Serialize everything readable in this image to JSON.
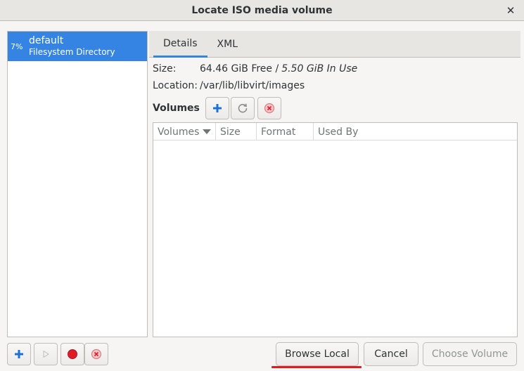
{
  "window": {
    "title": "Locate ISO media volume"
  },
  "pools": [
    {
      "percent": "7%",
      "name": "default",
      "type": "Filesystem Directory"
    }
  ],
  "tabs": [
    {
      "label": "Details",
      "active": true
    },
    {
      "label": "XML",
      "active": false
    }
  ],
  "details": {
    "size_label": "Size:",
    "size_free": "64.46 GiB Free /",
    "size_in_use": "5.50 GiB In Use",
    "location_label": "Location:",
    "location_value": "/var/lib/libvirt/images",
    "volumes_label": "Volumes"
  },
  "volume_table": {
    "columns": [
      "Volumes",
      "Size",
      "Format",
      "Used By"
    ],
    "sort_column": "Volumes",
    "rows": []
  },
  "buttons": {
    "browse_local": "Browse Local",
    "cancel": "Cancel",
    "choose_volume": "Choose Volume"
  },
  "colors": {
    "accent": "#3584e4",
    "delete_red": "#e01b24",
    "add_blue": "#1c71d8"
  },
  "icons": {
    "add_volume": "plus-icon",
    "refresh": "refresh-icon",
    "delete": "delete-icon",
    "add_pool": "plus-icon",
    "start_pool": "play-icon",
    "stop_pool": "stop-icon",
    "delete_pool": "delete-icon",
    "close": "close-icon"
  }
}
